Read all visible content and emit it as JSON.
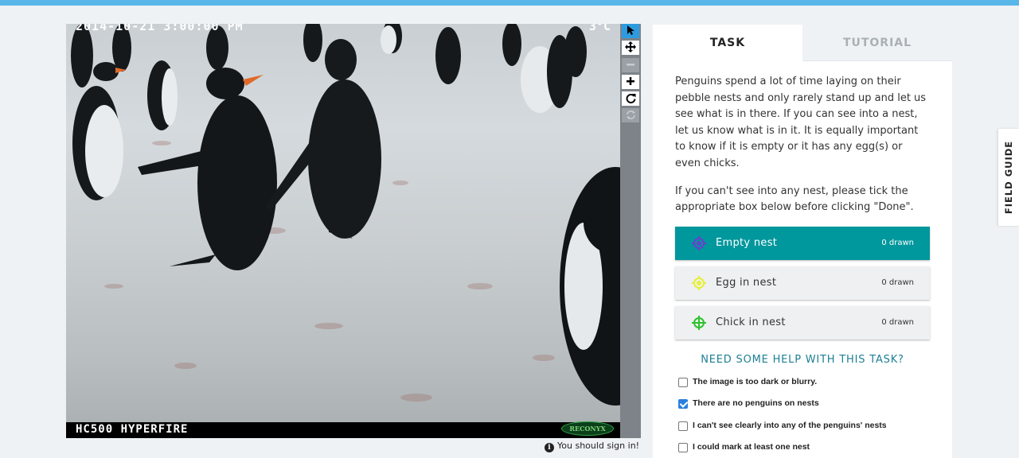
{
  "viewer": {
    "timestamp": "2014-10-21  3:00:00 PM",
    "temperature": "3°C",
    "camera_model": "HC500 HYPERFIRE",
    "brand": "RECONYX",
    "tools": [
      "pointer-icon",
      "move-icon",
      "zoom-out-icon",
      "zoom-in-icon",
      "rotate-icon",
      "reset-icon"
    ],
    "signin_notice": "You should sign in!"
  },
  "tabs": {
    "task": "TASK",
    "tutorial": "TUTORIAL"
  },
  "instructions": {
    "p1": "Penguins spend a lot of time laying on their pebble nests and only rarely stand up and let us see what is in there. If you can see into a nest, let us know what is in it. It is equally important to know if it is empty or it has any egg(s) or even chicks.",
    "p2": "If you can't see into any nest, please tick the appropriate box below before clicking \"Done\"."
  },
  "choices": [
    {
      "label": "Empty nest",
      "count": "0 drawn",
      "color": "#6a3fcf",
      "selected": true
    },
    {
      "label": "Egg in nest",
      "count": "0 drawn",
      "color": "#e7ef3a",
      "selected": false
    },
    {
      "label": "Chick in nest",
      "count": "0 drawn",
      "color": "#2dc22d",
      "selected": false
    }
  ],
  "help": {
    "title": "NEED SOME HELP WITH THIS TASK?",
    "checks": [
      {
        "label": "The image is too dark or blurry.",
        "checked": false
      },
      {
        "label": "There are no penguins on nests",
        "checked": true
      },
      {
        "label": "I can't see clearly into any of the penguins' nests",
        "checked": false
      },
      {
        "label": "I could mark at least one nest",
        "checked": false
      }
    ]
  },
  "field_guide": "FIELD GUIDE",
  "colors": {
    "accent": "#00979d",
    "topbar": "#58b7e8",
    "help_title": "#1d7f95"
  }
}
